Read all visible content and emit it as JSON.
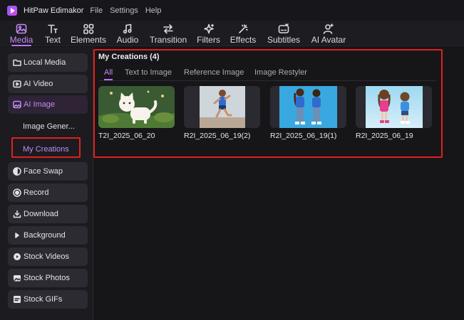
{
  "titlebar": {
    "app_title": "HitPaw Edimakor",
    "menu": [
      "File",
      "Settings",
      "Help"
    ]
  },
  "toolbar": {
    "items": [
      {
        "label": "Media",
        "icon": "media-icon",
        "active": true
      },
      {
        "label": "Text",
        "icon": "text-icon"
      },
      {
        "label": "Elements",
        "icon": "elements-icon"
      },
      {
        "label": "Audio",
        "icon": "audio-icon"
      },
      {
        "label": "Transition",
        "icon": "transition-icon"
      },
      {
        "label": "Filters",
        "icon": "filters-icon"
      },
      {
        "label": "Effects",
        "icon": "effects-icon"
      },
      {
        "label": "Subtitles",
        "icon": "subtitles-icon"
      },
      {
        "label": "AI Avatar",
        "icon": "ai-avatar-icon"
      }
    ],
    "accent_color": "#b975f2"
  },
  "sidebar": {
    "items": [
      {
        "label": "Local Media",
        "icon": "folder-icon"
      },
      {
        "label": "AI Video",
        "icon": "ai-video-icon"
      },
      {
        "label": "AI Image",
        "icon": "ai-image-icon",
        "expanded": true
      },
      {
        "label": "Face Swap",
        "icon": "face-swap-icon"
      },
      {
        "label": "Record",
        "icon": "record-icon"
      },
      {
        "label": "Download",
        "icon": "download-icon"
      },
      {
        "label": "Background",
        "icon": "background-icon"
      },
      {
        "label": "Stock Videos",
        "icon": "stock-videos-icon"
      },
      {
        "label": "Stock Photos",
        "icon": "stock-photos-icon"
      },
      {
        "label": "Stock GIFs",
        "icon": "gif-icon"
      }
    ],
    "sub_items": [
      {
        "label": "Image Gener...",
        "selected": false
      },
      {
        "label": "My Creations",
        "selected": true
      }
    ]
  },
  "main": {
    "title": "My Creations (4)",
    "tabs": [
      {
        "label": "All",
        "active": true
      },
      {
        "label": "Text to Image"
      },
      {
        "label": "Reference Image"
      },
      {
        "label": "Image Restyler"
      }
    ],
    "items": [
      {
        "name": "T2I_2025_06_20",
        "thumb": "cat-illustration"
      },
      {
        "name": "R2I_2025_06_19(2)",
        "thumb": "running-boy"
      },
      {
        "name": "R2I_2025_06_19(1)",
        "thumb": "two-kids-blue"
      },
      {
        "name": "R2I_2025_06_19",
        "thumb": "two-kids-cartoon"
      }
    ]
  },
  "highlight_color": "#e0201f"
}
